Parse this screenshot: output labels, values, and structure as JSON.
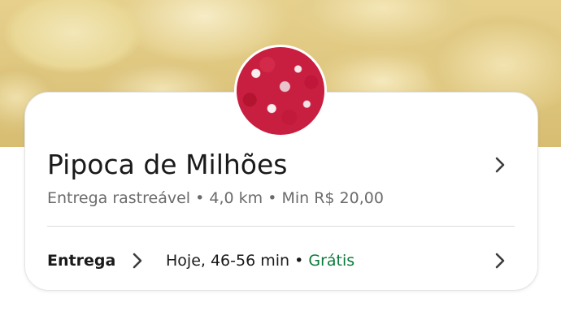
{
  "store": {
    "name": "Pipoca de Milhões",
    "info": {
      "tracking": "Entrega rastreável",
      "distance": "4,0 km",
      "minimum": "Min R$ 20,00",
      "separator": " • "
    }
  },
  "delivery": {
    "label": "Entrega",
    "time": "Hoje, 46-56 min",
    "separator": " • ",
    "fee": "Grátis"
  },
  "colors": {
    "free_green": "#0b7a3b",
    "text_dark": "#1a1a1a",
    "text_muted": "#6b6b6b"
  },
  "icons": {
    "store_chevron": "chevron-right-icon",
    "delivery_chevron": "chevron-right-icon"
  }
}
